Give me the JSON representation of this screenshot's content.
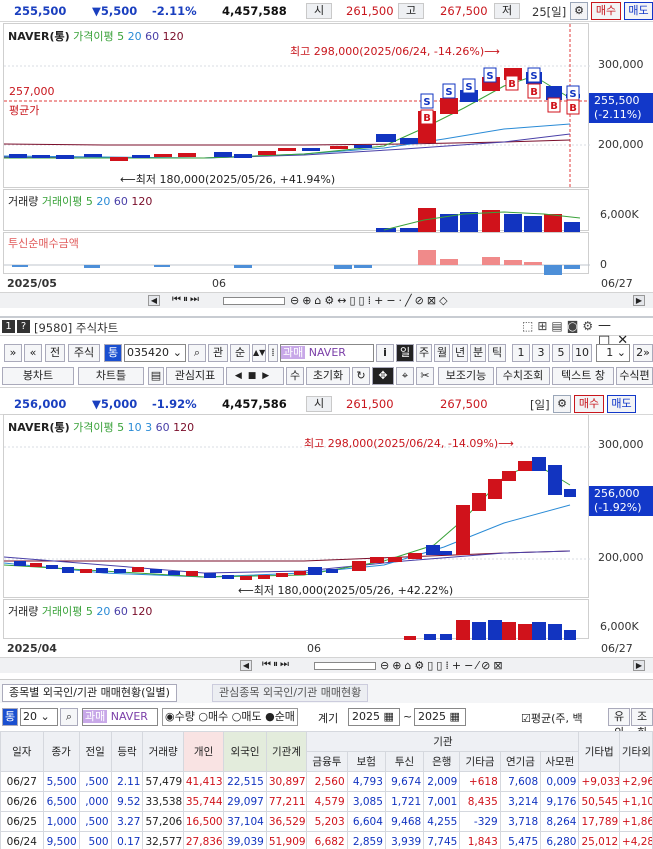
{
  "top": {
    "price": "255,500",
    "change": "▼5,500",
    "pct": "-2.11%",
    "volume": "4,457,588",
    "open_label": "시",
    "open": "261,500",
    "high_label": "고",
    "high": "267,500",
    "low_label": "저",
    "period": "25[일]",
    "buy": "매수",
    "sell": "매도",
    "legend_name": "NAVER(통)",
    "legend_ma_label": "가격이평 5",
    "legend_ma": [
      "20",
      "60",
      "120"
    ],
    "high_note": "최고 298,000(2025/06/24, -14.26%)⟶",
    "low_note": "⟵최저 180,000(2025/05/26, +41.94%)",
    "avg_value": "257,000",
    "avg_label": "평균가",
    "yaxis": [
      "300,000",
      "200,000"
    ],
    "price_box_1": "255,500",
    "price_box_2": "(-2.11%)",
    "vol_label": "거래량",
    "vol_ma_label": "거래이평 5",
    "vol_ma": [
      "20",
      "60",
      "120"
    ],
    "vol_axis": "6,000K",
    "inv_label": "투신순매수금액",
    "inv_axis": "0",
    "date_left": "2025/05",
    "date_mid": "06",
    "date_right": "06/27"
  },
  "window": {
    "num": "1",
    "help": "?",
    "title": "[9580] 주식차트",
    "toolbar1": [
      "전",
      "주식",
      "통"
    ],
    "code": "035420",
    "tb1_more": [
      "관",
      "순"
    ],
    "market_tag": "과매",
    "stock_name": "NAVER",
    "periods": [
      "i",
      "일",
      "주",
      "월",
      "년",
      "분",
      "틱",
      "1",
      "3",
      "5",
      "10",
      "1"
    ],
    "toolbar2": [
      "봉차트",
      "차트틀",
      "관심지표",
      "수",
      "초기화",
      "보조기능",
      "수치조회",
      "텍스트 창",
      "수식편"
    ]
  },
  "bottom": {
    "price": "256,000",
    "change": "▼5,000",
    "pct": "-1.92%",
    "volume": "4,457,586",
    "open_label": "시",
    "open": "261,500",
    "high": "267,500",
    "period": "[일]",
    "buy": "매수",
    "sell": "매도",
    "legend_name": "NAVER(통)",
    "legend_ma_label": "가격이평 5",
    "legend_ma": [
      "10",
      "3",
      "60",
      "120"
    ],
    "high_note": "최고 298,000(2025/06/24, -14.09%)⟶",
    "low_note": "⟵최저 180,000(2025/05/26, +42.22%)",
    "yaxis": [
      "300,000",
      "200,000"
    ],
    "price_box_1": "256,000",
    "price_box_2": "(-1.92%)",
    "vol_label": "거래량",
    "vol_ma_label": "거래이평 5",
    "vol_ma": [
      "20",
      "60",
      "120"
    ],
    "vol_axis": "6,000K",
    "date_left": "2025/04",
    "date_mid": "06",
    "date_right": "06/27"
  },
  "panel": {
    "tab1": "종목별 외국인/기관 매매현황(일별)",
    "tab2": "관심종목 외국인/기관 매매현황",
    "prefix": "통",
    "count": "20",
    "tag": "과매",
    "name": "NAVER",
    "radio1": "수량",
    "radio2": "매수",
    "radio3": "매도",
    "radio4": "순매",
    "period_label": "계기",
    "from": "2025",
    "to": "2025",
    "check": "평균(주, 백",
    "btn1": "유의",
    "btn2": "조회",
    "headers": [
      "일자",
      "종가",
      "전일",
      "등락",
      "거래량",
      "개인",
      "외국인",
      "기관계"
    ],
    "inst_header": "기관",
    "inst_sub": [
      "금융투",
      "보험",
      "투신",
      "은행",
      "기타금",
      "연기금",
      "사모펀"
    ],
    "tail": [
      "기타법",
      "기타외"
    ],
    "rows": [
      [
        "06/27",
        "5,500",
        ",500",
        "2.11",
        "57,479",
        "41,413",
        "22,515",
        "30,897",
        "2,560",
        "4,793",
        "9,674",
        "2,009",
        "+618",
        "7,608",
        "0,009",
        "+9,033",
        "+2,966"
      ],
      [
        "06/26",
        "6,500",
        ",000",
        "9.52",
        "33,538",
        "35,744",
        "29,097",
        "77,211",
        "4,579",
        "3,085",
        "1,721",
        "7,001",
        "8,435",
        "3,214",
        "9,176",
        "50,545",
        "+1,109"
      ],
      [
        "06/25",
        "1,000",
        ",500",
        "3.27",
        "57,206",
        "16,500",
        "37,104",
        "36,529",
        "5,203",
        "6,604",
        "9,468",
        "4,255",
        "-329",
        "3,718",
        "8,264",
        "17,789",
        "+1,864"
      ],
      [
        "06/24",
        "9,500",
        "500",
        "0.17",
        "32,577",
        "27,836",
        "39,039",
        "51,909",
        "6,682",
        "2,859",
        "3,939",
        "7,745",
        "1,843",
        "5,475",
        "6,280",
        "25,012",
        "+4,282"
      ],
      [
        "06/23",
        "4,500",
        "000",
        "5.57",
        "32,836",
        "15,925",
        "15,608",
        "71,161",
        "9,990",
        "5,154",
        "2,481",
        "5,731",
        "1,914",
        "6,158",
        "8,825",
        "39,921",
        "+1,557"
      ]
    ]
  },
  "colors": {
    "up": "#d0121b",
    "down": "#1234c0",
    "accent": "#1238c9",
    "buy": "#c8161d",
    "sell": "#1238c9"
  }
}
